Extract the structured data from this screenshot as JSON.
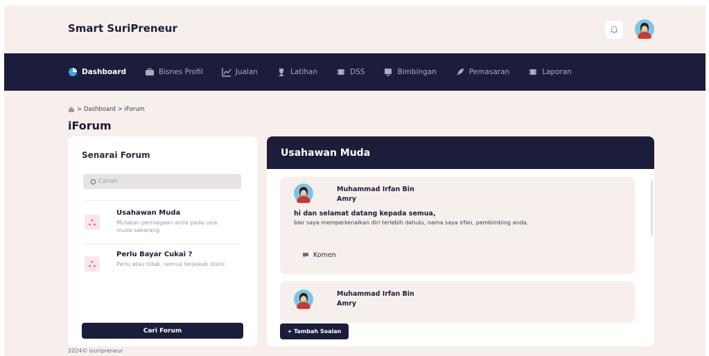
{
  "header": {
    "brand": "Smart SuriPreneur",
    "icons": [
      "bell-icon",
      "user-avatar"
    ]
  },
  "nav": {
    "items": [
      {
        "label": "Dashboard",
        "icon": "pie-chart-icon",
        "active": true
      },
      {
        "label": "Bisnes Profil",
        "icon": "briefcase-icon"
      },
      {
        "label": "Jualan",
        "icon": "line-chart-icon"
      },
      {
        "label": "Latihan",
        "icon": "trophy-icon"
      },
      {
        "label": "DSS",
        "icon": "chip-icon"
      },
      {
        "label": "Bimbingan",
        "icon": "monitor-icon"
      },
      {
        "label": "Pemasaran",
        "icon": "rocket-icon"
      },
      {
        "label": "Laporan",
        "icon": "chip-icon"
      }
    ]
  },
  "breadcrumb": {
    "home_icon": "home-icon",
    "text": "> Dashboard > iForum"
  },
  "page_title": "iForum",
  "forum_list": {
    "title": "Senarai Forum",
    "search_placeholder": "Carian",
    "items": [
      {
        "title": "Usahawan Muda",
        "desc": "Mulakan perniagaan anda pada usia muda sekarang",
        "icon": "network-icon"
      },
      {
        "title": "Perlu Bayar Cukai ?",
        "desc": "Perlu atau tidak, semua terjawab disini",
        "icon": "network-icon"
      }
    ],
    "button": "Cari Forum"
  },
  "thread": {
    "title": "Usahawan Muda",
    "posts": [
      {
        "author": "Muhammad Irfan Bin Amry",
        "title": "hi dan selamat datang kepada semua,",
        "body": "biar saya memperkenalkan diri terlebih dahulu, nama saya irfan, pembimbing anda.",
        "comment_label": "Komen"
      },
      {
        "author": "Muhammad Irfan Bin Amry"
      }
    ],
    "add_button": "+ Tambah Soalan"
  },
  "footer": "2024© isuripreneur",
  "colors": {
    "navy": "#1b1d3a",
    "background": "#f7efeb",
    "card": "#ffffff",
    "muted": "#9a9bb0",
    "accent_pink": "#fbe4ea"
  }
}
